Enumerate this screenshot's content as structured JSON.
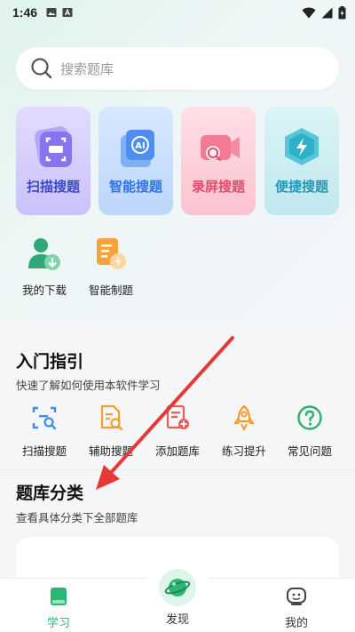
{
  "status_bar": {
    "time": "1:46",
    "icons": [
      "image-icon",
      "a-icon",
      "wifi-icon",
      "signal-icon",
      "battery-icon"
    ]
  },
  "search": {
    "placeholder": "搜索题库",
    "icon": "search-icon"
  },
  "features": [
    {
      "label": "扫描搜题",
      "icon": "scan-icon",
      "color": "#3b49c9"
    },
    {
      "label": "智能搜题",
      "icon": "ai-icon",
      "color": "#2f73e6"
    },
    {
      "label": "录屏搜题",
      "icon": "record-icon",
      "color": "#e24b6b"
    },
    {
      "label": "便捷搜题",
      "icon": "lightning-icon",
      "color": "#1e9bb8"
    }
  ],
  "quick_items": [
    {
      "label": "我的下载",
      "icon": "download-icon"
    },
    {
      "label": "智能制题",
      "icon": "smart-create-icon"
    }
  ],
  "guide": {
    "title": "入门指引",
    "subtitle": "快速了解如何使用本软件学习",
    "items": [
      {
        "label": "扫描搜题",
        "icon": "scan-search-icon"
      },
      {
        "label": "辅助搜题",
        "icon": "assist-search-icon"
      },
      {
        "label": "添加题库",
        "icon": "add-bank-icon"
      },
      {
        "label": "练习提升",
        "icon": "rocket-icon"
      },
      {
        "label": "常见问题",
        "icon": "question-icon"
      }
    ]
  },
  "category": {
    "title": "题库分类",
    "subtitle": "查看具体分类下全部题库"
  },
  "tabbar": {
    "tabs": [
      {
        "label": "学习",
        "icon": "book-icon",
        "active": true
      },
      {
        "label": "发现",
        "icon": "planet-icon",
        "active": false
      },
      {
        "label": "我的",
        "icon": "profile-icon",
        "active": false
      }
    ]
  },
  "colors": {
    "accent": "#2bb673",
    "arrow": "#e53935"
  }
}
